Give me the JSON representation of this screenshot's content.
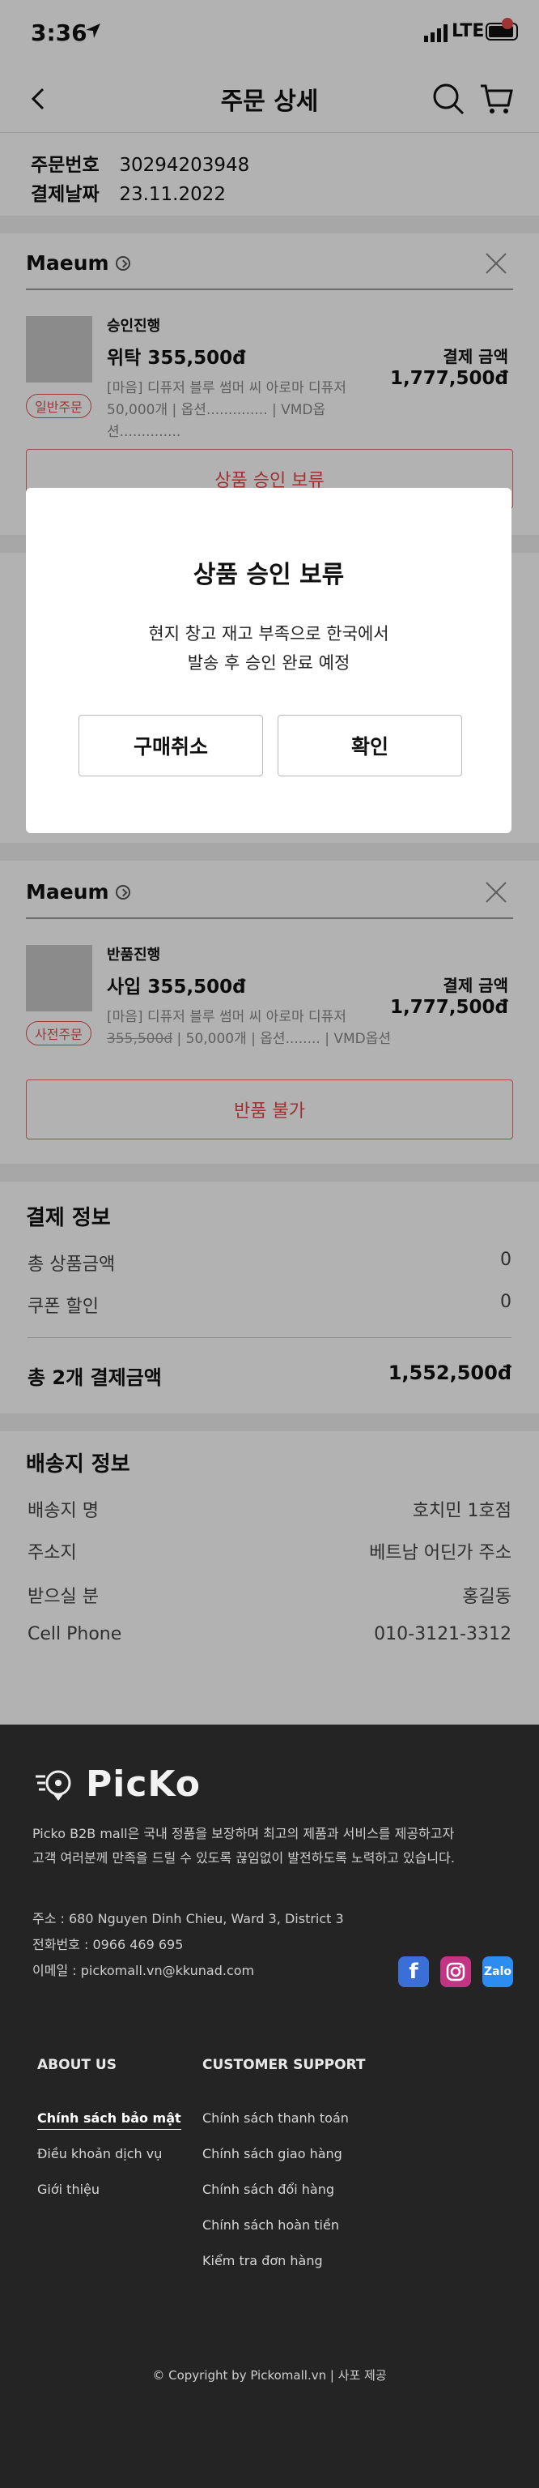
{
  "status_bar": {
    "time": "3:36",
    "network": "LTE"
  },
  "header": {
    "title": "주문 상세"
  },
  "order": {
    "number_label": "주문번호",
    "number": "30294203948",
    "date_label": "결제날짜",
    "date": "23.11.2022"
  },
  "store1": {
    "name": "Maeum",
    "status": "승인진행",
    "product": "위탁  355,500đ",
    "options_line1": "[마음] 디퓨저 블루 썸머 씨 아로마 디퓨저",
    "options_line2": "50,000개 | 옵션.............. | VMD옵션..............",
    "badge": "일반주문",
    "pay_label": "결제 금액",
    "pay_value": "1,777,500đ",
    "action": "상품 승인 보류"
  },
  "store2": {
    "name": "Maeum",
    "status": "반품진행",
    "product": "사입  355,500đ",
    "options_line1": "[마음] 디퓨저 블루 썸머 씨 아로마 디퓨저",
    "strike_price": "355,500đ",
    "options_line2": " | 50,000개 | 옵션........ | VMD옵션",
    "badge": "사전주문",
    "pay_label": "결제 금액",
    "pay_value": "1,777,500đ",
    "action": "반품 불가"
  },
  "payment": {
    "title": "결제 정보",
    "subtotal_label": "총 상품금액",
    "subtotal": "0",
    "coupon_label": "쿠폰 할인",
    "coupon": "0",
    "total_label": "총 2개 결제금액",
    "total": "1,552,500đ"
  },
  "shipping": {
    "title": "배송지 정보",
    "rows": [
      {
        "label": "배송지 명",
        "value": "호치민 1호점"
      },
      {
        "label": "주소지",
        "value": "베트남 어딘가 주소"
      },
      {
        "label": "받으실 분",
        "value": "홍길동"
      },
      {
        "label": "Cell Phone",
        "value": "010-3121-3312"
      }
    ]
  },
  "modal": {
    "title": "상품 승인 보류",
    "message_line1": "현지 창고 재고 부족으로 한국에서",
    "message_line2": "발송 후 승인 완료 예정",
    "cancel": "구매취소",
    "confirm": "확인"
  },
  "footer": {
    "brand": "PicKo",
    "desc_line1": "Picko B2B mall은 국내 정품을 보장하며 최고의 제품과 서비스를 제공하고자",
    "desc_line2": "고객 여러분께 만족을 드릴 수 있도록 끊임없이 발전하도록 노력하고 있습니다.",
    "address": "주소 : 680 Nguyen Dinh Chieu, Ward 3, District 3",
    "phone": "전화번호 : 0966 469 695",
    "email": "이메일 : pickomall.vn@kkunad.com",
    "about_title": "ABOUT US",
    "about_links": [
      "Chính sách bảo mật",
      "Điều khoản dịch vụ",
      "Giới thiệu"
    ],
    "support_title": "CUSTOMER SUPPORT",
    "support_links": [
      "Chính sách thanh toán",
      "Chính sách giao hàng",
      "Chính sách đổi hàng",
      "Chính sách hoàn tiền",
      "Kiểm tra đơn hàng"
    ],
    "copyright": "© Copyright by Pickomall.vn | 사포 제공",
    "social": {
      "facebook_color": "#3b6fd8",
      "instagram_color": "#c13584",
      "zalo_color": "#2d8cf0",
      "zalo_text": "Zalo"
    }
  }
}
